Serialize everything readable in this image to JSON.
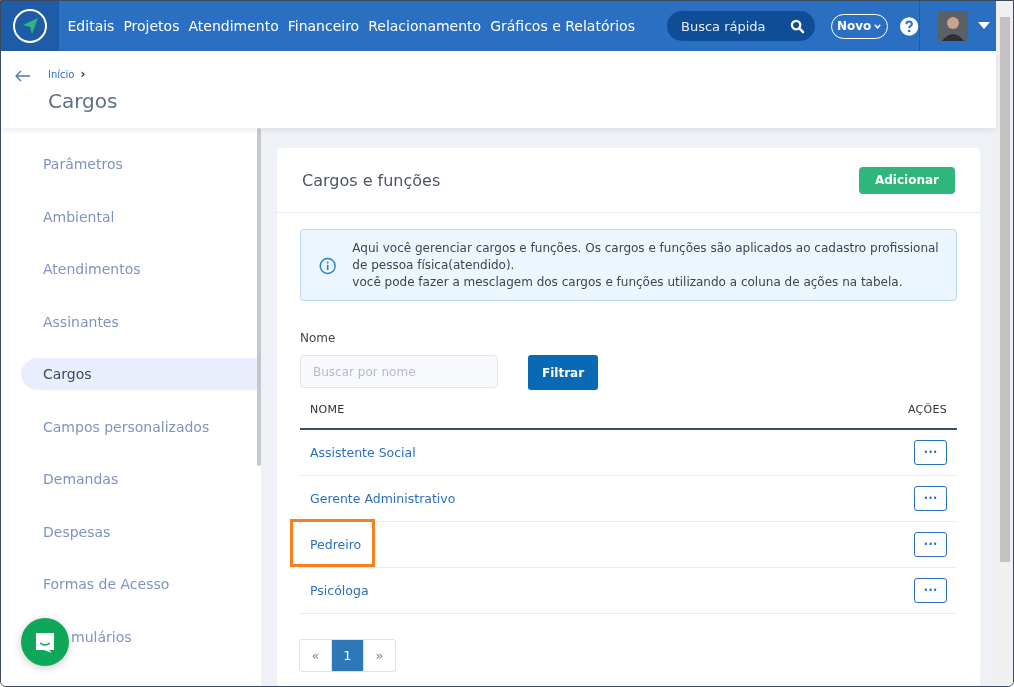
{
  "nav": {
    "items": [
      "Editais",
      "Projetos",
      "Atendimento",
      "Financeiro",
      "Relacionamento",
      "Gráficos e Relatórios"
    ],
    "search": {
      "placeholder": "Busca rápida"
    },
    "new_button": "Novo"
  },
  "header": {
    "breadcrumb": "Início",
    "breadcrumb_sep": "›",
    "title": "Cargos"
  },
  "sidebar": {
    "items": [
      {
        "label": "Parâmetros",
        "selected": false
      },
      {
        "label": "Ambiental",
        "selected": false
      },
      {
        "label": "Atendimentos",
        "selected": false
      },
      {
        "label": "Assinantes",
        "selected": false
      },
      {
        "label": "Cargos",
        "selected": true
      },
      {
        "label": "Campos personalizados",
        "selected": false
      },
      {
        "label": "Demandas",
        "selected": false
      },
      {
        "label": "Despesas",
        "selected": false
      },
      {
        "label": "Formas de Acesso",
        "selected": false
      },
      {
        "label": "mulários",
        "selected": false,
        "covered": true
      }
    ]
  },
  "card": {
    "title": "Cargos e funções",
    "add_button": "Adicionar",
    "info": [
      "Aqui você gerenciar cargos e funções. Os cargos e funções são aplicados ao cadastro profissional de pessoa física(atendido).",
      "você pode fazer a mesclagem dos cargos e funções utilizando a coluna de ações na tabela."
    ],
    "filter": {
      "label": "Nome",
      "placeholder": "Buscar por nome",
      "button": "Filtrar"
    },
    "table": {
      "columns": [
        "NOME",
        "AÇÕES"
      ],
      "rows": [
        {
          "name": "Assistente Social",
          "action": "•••",
          "highlighted": false
        },
        {
          "name": "Gerente Administrativo",
          "action": "•••",
          "highlighted": false
        },
        {
          "name": "Pedreiro",
          "action": "•••",
          "highlighted": true
        },
        {
          "name": "Psicóloga",
          "action": "•••",
          "highlighted": false
        }
      ]
    },
    "pagination": [
      {
        "label": "«",
        "selected": false
      },
      {
        "label": "1",
        "selected": true
      },
      {
        "label": "»",
        "selected": false
      }
    ]
  }
}
